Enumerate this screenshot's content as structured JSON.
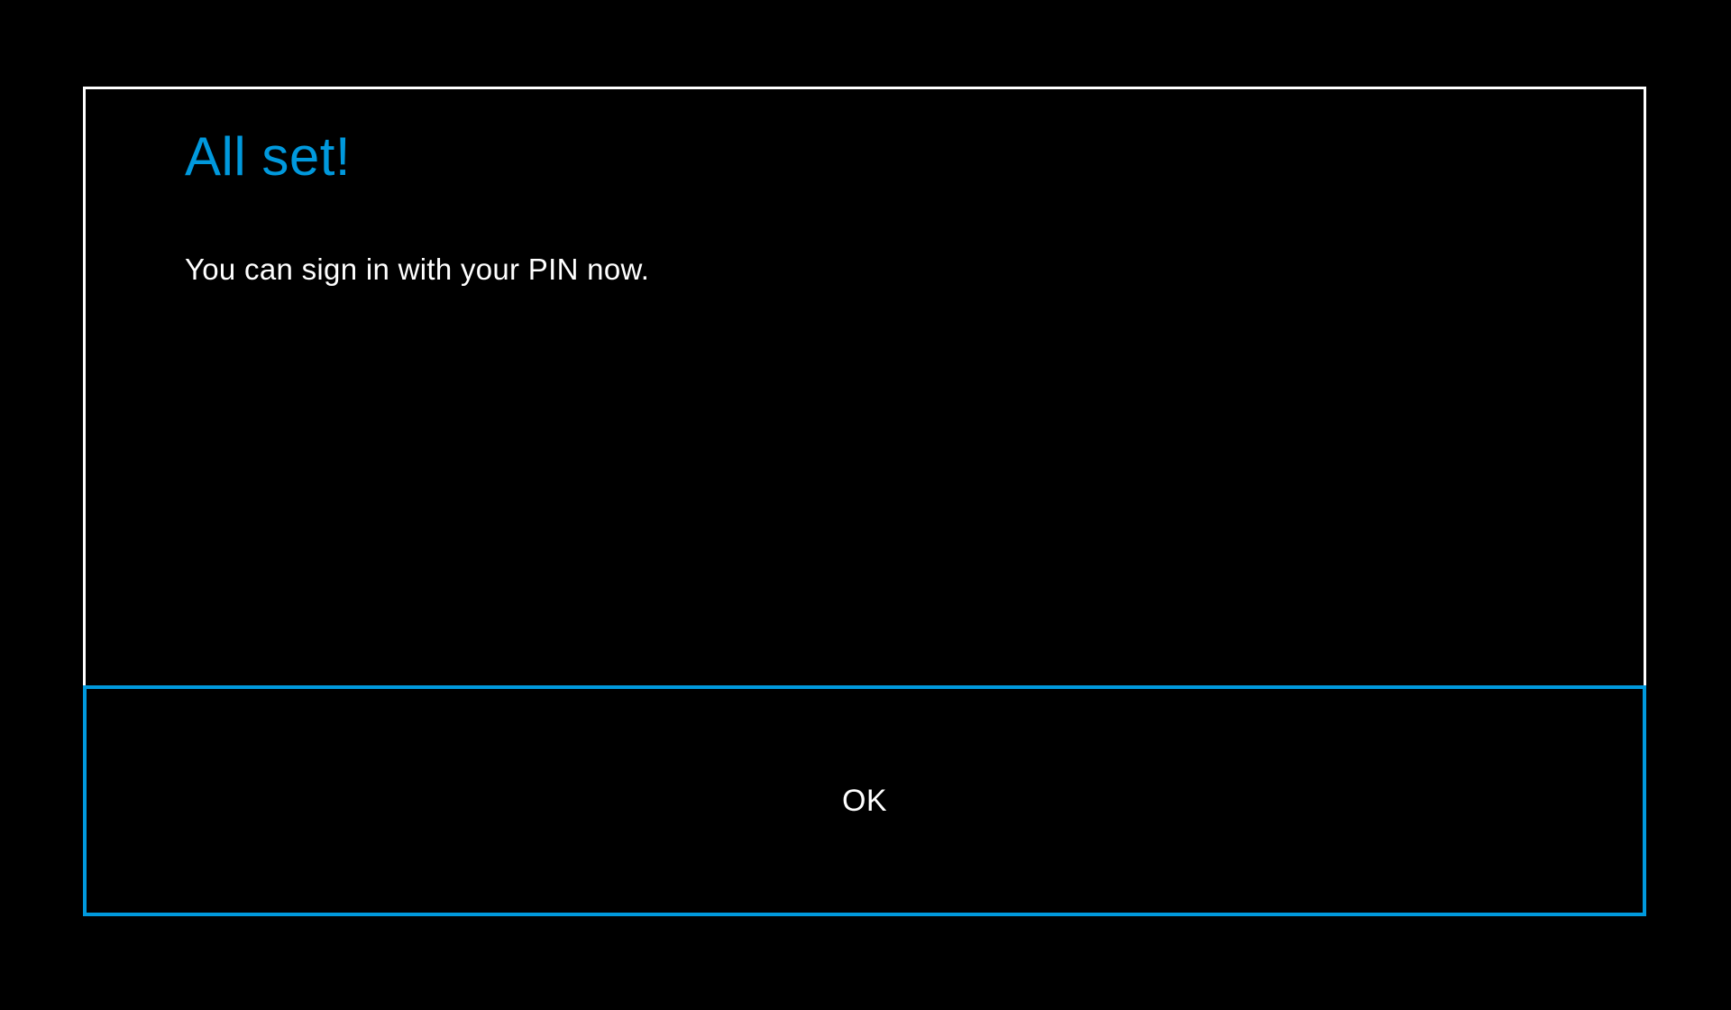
{
  "dialog": {
    "title": "All set!",
    "message": "You can sign in with your PIN now.",
    "ok_label": "OK"
  },
  "colors": {
    "accent": "#0099dd",
    "background": "#000000",
    "border": "#ffffff",
    "text": "#ffffff"
  }
}
